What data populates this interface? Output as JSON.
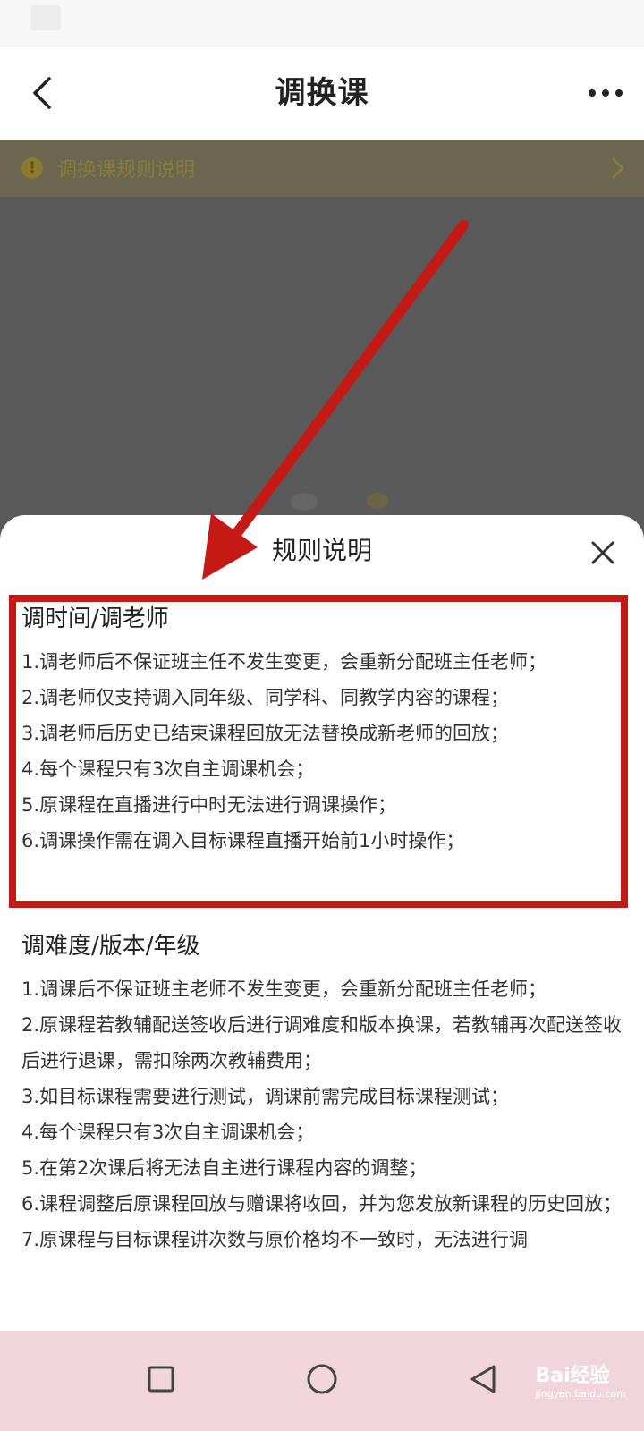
{
  "header": {
    "title": "调换课"
  },
  "notice": {
    "text": "调换课规则说明"
  },
  "sheet": {
    "title": "规则说明",
    "sections": [
      {
        "heading": "调时间/调老师",
        "items": [
          "1.调老师后不保证班主任不发生变更，会重新分配班主任老师；",
          "2.调老师仅支持调入同年级、同学科、同教学内容的课程；",
          "3.调老师后历史已结束课程回放无法替换成新老师的回放；",
          "4.每个课程只有3次自主调课机会；",
          "5.原课程在直播进行中时无法进行调课操作；",
          "6.调课操作需在调入目标课程直播开始前1小时操作；"
        ]
      },
      {
        "heading": "调难度/版本/年级",
        "items": [
          "1.调课后不保证班主老师不发生变更，会重新分配班主任老师；",
          "2.原课程若教辅配送签收后进行调难度和版本换课，若教辅再次配送签收后进行退课，需扣除两次教辅费用；",
          "3.如目标课程需要进行测试，调课前需完成目标课程测试；",
          "4.每个课程只有3次自主调课机会；",
          "5.在第2次课后将无法自主进行课程内容的调整；",
          "6.课程调整后原课程回放与赠课将收回，并为您发放新课程的历史回放；",
          "7.原课程与目标课程讲次数与原价格均不一致时，无法进行调"
        ]
      }
    ]
  },
  "watermark": {
    "brand": "Bai经验",
    "url": "jingyan.baidu.com"
  },
  "colors": {
    "annotation_red": "#c41a15",
    "dim_overlay": "#5a5a5a",
    "nav_bar": "#f0d6dc"
  },
  "icons": {
    "back": "chevron-left-icon",
    "more": "more-dots-icon",
    "warning": "warning-circle-icon",
    "close": "close-icon",
    "recent": "square-icon",
    "home": "circle-icon",
    "nav_back": "triangle-back-icon"
  }
}
